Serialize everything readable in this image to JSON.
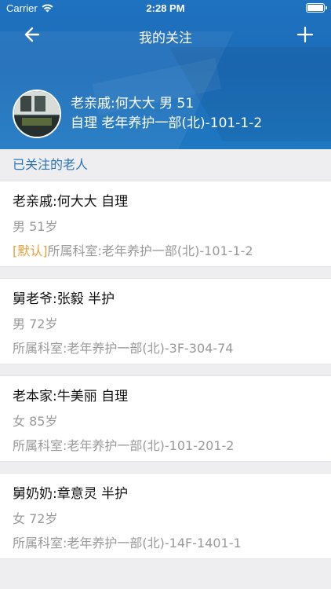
{
  "status_bar": {
    "carrier": "Carrier",
    "time": "2:28 PM"
  },
  "nav": {
    "title": "我的关注"
  },
  "profile": {
    "line1": "老亲戚:何大大 男 51",
    "line2": "自理 老年养护一部(北)-101-1-2"
  },
  "section": {
    "title": "已关注的老人"
  },
  "cards": [
    {
      "title": "老亲戚:何大大 自理",
      "sub": "男 51岁",
      "tag": "[默认]",
      "dept": "所属科室:老年养护一部(北)-101-1-2"
    },
    {
      "title": "舅老爷:张毅 半护",
      "sub": "男 72岁",
      "tag": "",
      "dept": "所属科室:老年养护一部(北)-3F-304-74"
    },
    {
      "title": "老本家:牛美丽 自理",
      "sub": "女 85岁",
      "tag": "",
      "dept": "所属科室:老年养护一部(北)-101-201-2"
    },
    {
      "title": "舅奶奶:章意灵 半护",
      "sub": "女 72岁",
      "tag": "",
      "dept": "所属科室:老年养护一部(北)-14F-1401-1"
    }
  ],
  "icons": {
    "back": "arrow-left-icon",
    "add": "plus-icon",
    "wifi": "wifi-icon",
    "battery": "battery-icon"
  },
  "colors": {
    "header_blue": "#1c6cb8",
    "section_title": "#2a75b8",
    "default_tag": "#e6a23c"
  }
}
